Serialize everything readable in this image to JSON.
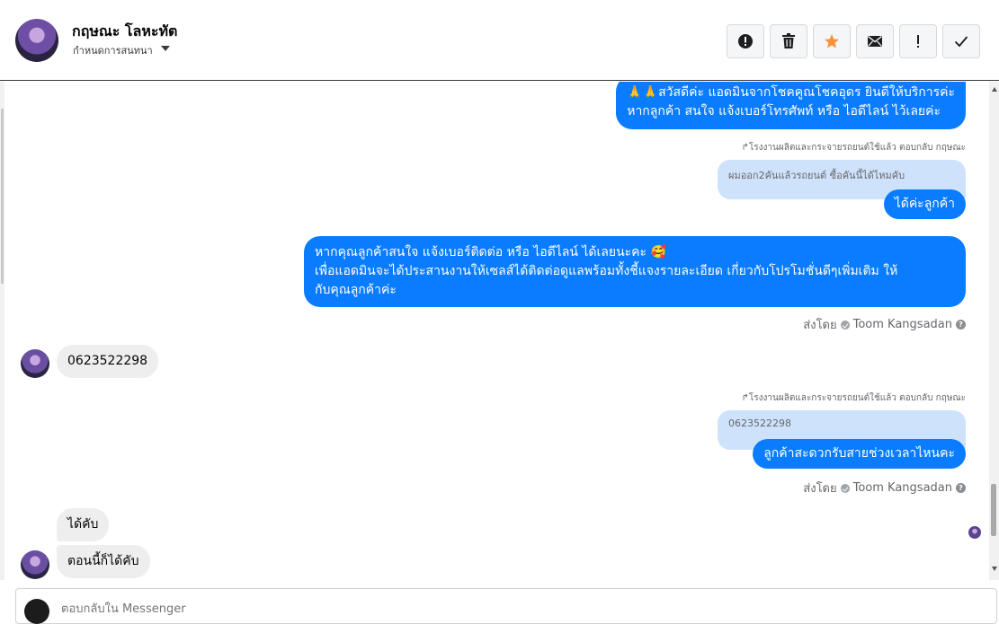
{
  "header": {
    "contact_name": "กฤษณะ โลหะทัต",
    "conversation_label": "กำหนดการสนทนา",
    "buttons": [
      {
        "icon": "exclamation-circle-icon",
        "label": "spam"
      },
      {
        "icon": "trash-icon",
        "label": "delete"
      },
      {
        "icon": "star-icon",
        "label": "star",
        "color": "#f7923a"
      },
      {
        "icon": "envelope-icon",
        "label": "mark unread"
      },
      {
        "icon": "exclamation-icon",
        "label": "follow up"
      },
      {
        "icon": "checkmark-icon",
        "label": "done"
      }
    ]
  },
  "messages": {
    "m1": {
      "line1": "🙏🙏สวัสดีค่ะ แอดมินจากโชคคูณโชคอุดร ยินดีให้บริการค่ะ",
      "line2": "หากลูกค้า สนใจ แจ้งเบอร์โทรศัพท์ หรือ ไอดีไลน์  ไว้เลยค่ะ"
    },
    "reply1": {
      "meta": "↱โรงงานผลิตและกระจายรถยนต์ใช้แล้ว ตอบกลับ กฤษณะ",
      "quoted": "ผมออก2คันแล้วรถยนต์ ซื้อคันนี้ได้ไหมคับ",
      "text": "ได้ค่ะลูกค้า"
    },
    "m3": {
      "line1": "หากคุณลูกค้าสนใจ แจ้งเบอร์ติดต่อ หรือ ไอดีไลน์ ได้เลยนะคะ 🥰",
      "line2": "เพื่อแอดมินจะได้ประสานงานให้เซลส์ได้ติดต่อดูแลพร้อมทั้งชี้แจงรายละเอียด เกี่ยวกับโปรโมชั่นดีๆเพิ่มเติม ให้",
      "line3": "กับคุณลูกค้าค่ะ"
    },
    "sent_by_1": {
      "prefix": "ส่งโดย",
      "name": "Toom Kangsadan"
    },
    "incoming_phone": "0623522298",
    "reply2": {
      "meta": "↱โรงงานผลิตและกระจายรถยนต์ใช้แล้ว ตอบกลับ กฤษณะ",
      "quoted": "0623522298",
      "text": "ลูกค้าสะดวกรับสายช่วงเวลาไหนคะ"
    },
    "sent_by_2": {
      "prefix": "ส่งโดย",
      "name": "Toom Kangsadan"
    },
    "incoming_1": "ได้คับ",
    "incoming_2": "ตอนนี้ก็ได้คับ"
  },
  "composer": {
    "placeholder": "ตอบกลับใน Messenger"
  }
}
